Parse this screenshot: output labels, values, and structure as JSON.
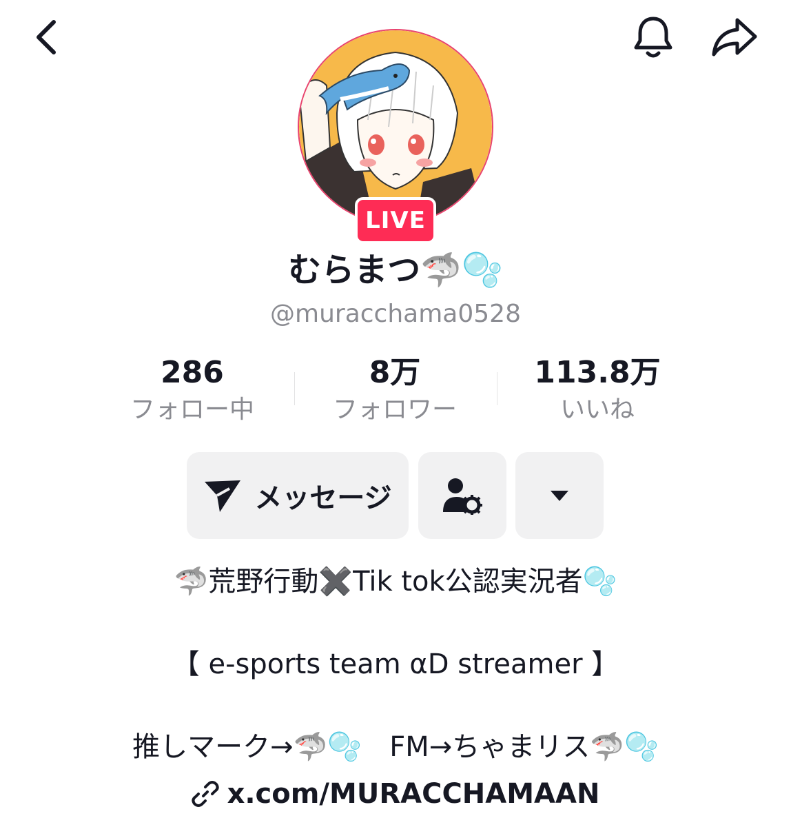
{
  "header": {
    "back_icon": "chevron-left-icon",
    "notify_icon": "bell-icon",
    "share_icon": "share-arrow-icon"
  },
  "profile": {
    "live_badge": "LIVE",
    "display_name": "むらまつ🦈🫧",
    "username": "@muracchama0528"
  },
  "stats": [
    {
      "value": "286",
      "label": "フォロー中"
    },
    {
      "value": "8万",
      "label": "フォロワー"
    },
    {
      "value": "113.8万",
      "label": "いいね"
    }
  ],
  "actions": {
    "message_label": "メッセージ",
    "message_icon": "send-icon",
    "profile_settings_icon": "user-gear-icon",
    "more_icon": "caret-down-icon"
  },
  "bio": {
    "line1": "🦈荒野行動✖️Tik tok公認実況者🫧",
    "line2": "【 e-sports team αD streamer 】",
    "line3": "推しマーク→🦈🫧　FM→ちゃまリス🦈🫧",
    "link": "x.com/MURACCHAMAAN",
    "link_icon": "link-icon"
  },
  "colors": {
    "live_badge": "#fe2c55",
    "avatar_ring": "#e8436f",
    "button_bg": "#f1f1f2",
    "secondary_text": "#8a8b91"
  }
}
